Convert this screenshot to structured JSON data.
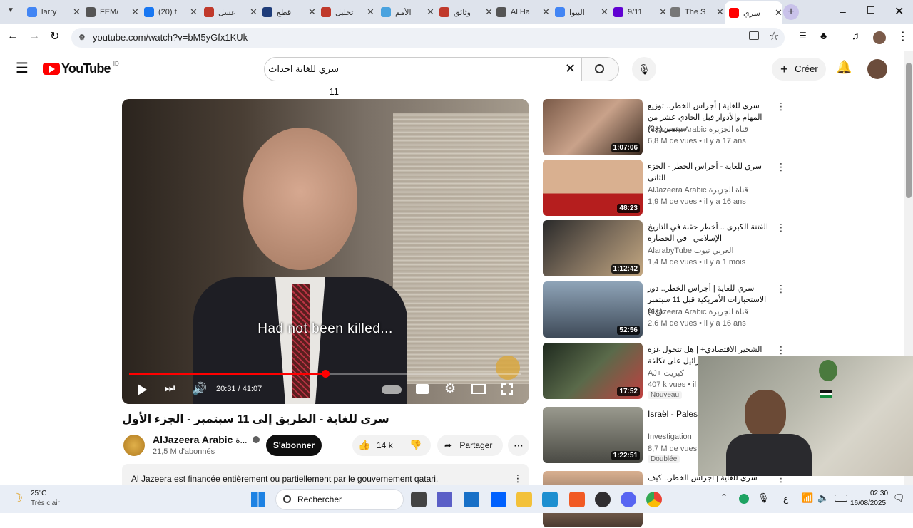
{
  "browser": {
    "tabs": [
      {
        "label": "larry",
        "icon": "google-icon"
      },
      {
        "label": "FEM/",
        "icon": "wikipedia-icon"
      },
      {
        "label": "(20) f",
        "icon": "facebook-icon"
      },
      {
        "label": "عسل",
        "icon": "site-icon"
      },
      {
        "label": "قطع",
        "icon": "bold-b-icon"
      },
      {
        "label": "تحليل",
        "icon": "site-icon"
      },
      {
        "label": "الأمم",
        "icon": "un-icon"
      },
      {
        "label": "وثائق",
        "icon": "site-icon"
      },
      {
        "label": "Al Ha",
        "icon": "wikipedia-icon"
      },
      {
        "label": "البيوا",
        "icon": "google-icon"
      },
      {
        "label": "9/11",
        "icon": "yahoo-icon"
      },
      {
        "label": "The S",
        "icon": "globe-icon"
      },
      {
        "label": "سري",
        "icon": "youtube-icon"
      }
    ],
    "url": "youtube.com/watch?v=bM5yGfx1KUk"
  },
  "youtube": {
    "logo_text": "YouTube",
    "region": "ID",
    "search_value": "سري للغاية احداث 11",
    "create_label": "Créer"
  },
  "video": {
    "subtitle": "Had not been killed...",
    "time": "20:31 / 41:07",
    "progress": 0.5,
    "title": "سري للغاية - الطريق إلى 11 سبتمبر - الجزء الأول",
    "channel": "AlJazeera Arabic",
    "channel_suffix": "ة...",
    "subscribers": "21,5 M d'abonnés",
    "subscribe_label": "S'abonner",
    "likes": "14 k",
    "share_label": "Partager",
    "funding_notice": "Al Jazeera est financée entièrement ou partiellement par le gouvernement qatari."
  },
  "sidebar": [
    {
      "title": "سري للغاية | أجراس الخطر.. توزيع المهام والأدوار قبل الحادي عشر من سبتمبر (ج2)",
      "channel": "AlJazeera Arabic قناة الجزيرة",
      "meta": "6,8 M de vues • il y a 17 ans",
      "duration": "1:07:06"
    },
    {
      "title": "سري للغاية - أجراس الخطر - الجزء الثاني",
      "channel": "AlJazeera Arabic قناة الجزيرة",
      "meta": "1,9 M de vues • il y a 16 ans",
      "duration": "48:23"
    },
    {
      "title": "الفتنة الكبرى .. أخطر حقبة في التاريخ الإسلامي | في الحضارة",
      "channel": "AlarabyTube العربي تيوب",
      "meta": "1,4 M de vues • il y a 1 mois",
      "duration": "1:12:42"
    },
    {
      "title": "سري للغاية | أجراس الخطر.. دور الاستخبارات الأمريكية قبل 11 سبتمبر (ج4)",
      "channel": "AlJazeera Arabic قناة الجزيرة",
      "meta": "2,6 M de vues • il y a 16 ans",
      "duration": "52:56"
    },
    {
      "title": "الشجير الاقتصادي+ | هل تتحول غزة إلى إسرائيل على تكلفة",
      "channel": "AJ+ كبريت",
      "meta": "407 k vues • il y",
      "duration": "17:52",
      "badge": "Nouveau"
    },
    {
      "title": "Israël - Palest violence",
      "channel": "Investigation",
      "meta": "8,7 M de vues • il y",
      "duration": "1:22:51",
      "badge": "Doublée"
    },
    {
      "title": "سري للغاية | أجراس الخطر.. كيف تؤثر",
      "channel": "",
      "meta": "",
      "duration": ""
    }
  ],
  "taskbar": {
    "weather_temp": "25°C",
    "weather_desc": "Très clair",
    "search_placeholder": "Rechercher",
    "time": "02:30",
    "date": "16/08/2025",
    "lang": "ع"
  }
}
